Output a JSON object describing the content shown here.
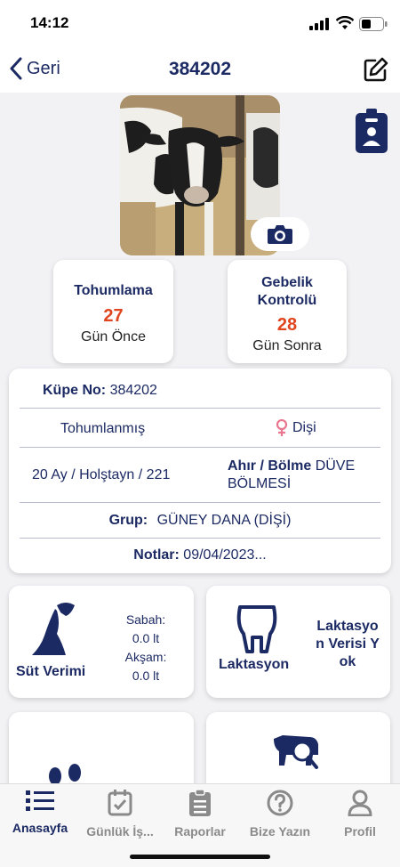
{
  "status_bar": {
    "time": "14:12"
  },
  "navbar": {
    "back_label": "Geri",
    "title": "384202"
  },
  "cards": {
    "insemination": {
      "title": "Tohumlama",
      "value": "27",
      "unit": "Gün Önce"
    },
    "pregnancy": {
      "title": "Gebelik Kontrolü",
      "value": "28",
      "unit": "Gün Sonra"
    }
  },
  "info": {
    "ear_tag_label": "Küpe No:",
    "ear_tag_value": "384202",
    "status": "Tohumlanmış",
    "gender": "Dişi",
    "age_breed": "20 Ay / Holştayn / 221",
    "barn_label": "Ahır / Bölme",
    "barn_value": "DÜVE BÖLMESİ",
    "group_label": "Grup:",
    "group_value": "GÜNEY DANA (DİŞİ)",
    "notes_label": "Notlar:",
    "notes_value": "09/04/2023..."
  },
  "milk": {
    "title": "Süt Verimi",
    "morning_label": "Sabah:",
    "morning_value": "0.0 lt",
    "evening_label": "Akşam:",
    "evening_value": "0.0 lt"
  },
  "lactation": {
    "title": "Laktasyon",
    "message": "Laktasyon Verisi Yok"
  },
  "tabs": [
    {
      "label": "Anasayfa",
      "icon": "list-icon"
    },
    {
      "label": "Günlük İş...",
      "icon": "calendar-check-icon"
    },
    {
      "label": "Raporlar",
      "icon": "clipboard-icon"
    },
    {
      "label": "Bize Yazın",
      "icon": "question-icon"
    },
    {
      "label": "Profil",
      "icon": "person-icon"
    }
  ],
  "colors": {
    "primary": "#1c2a64",
    "accent": "#e0451e",
    "gender_icon": "#e8778f"
  }
}
